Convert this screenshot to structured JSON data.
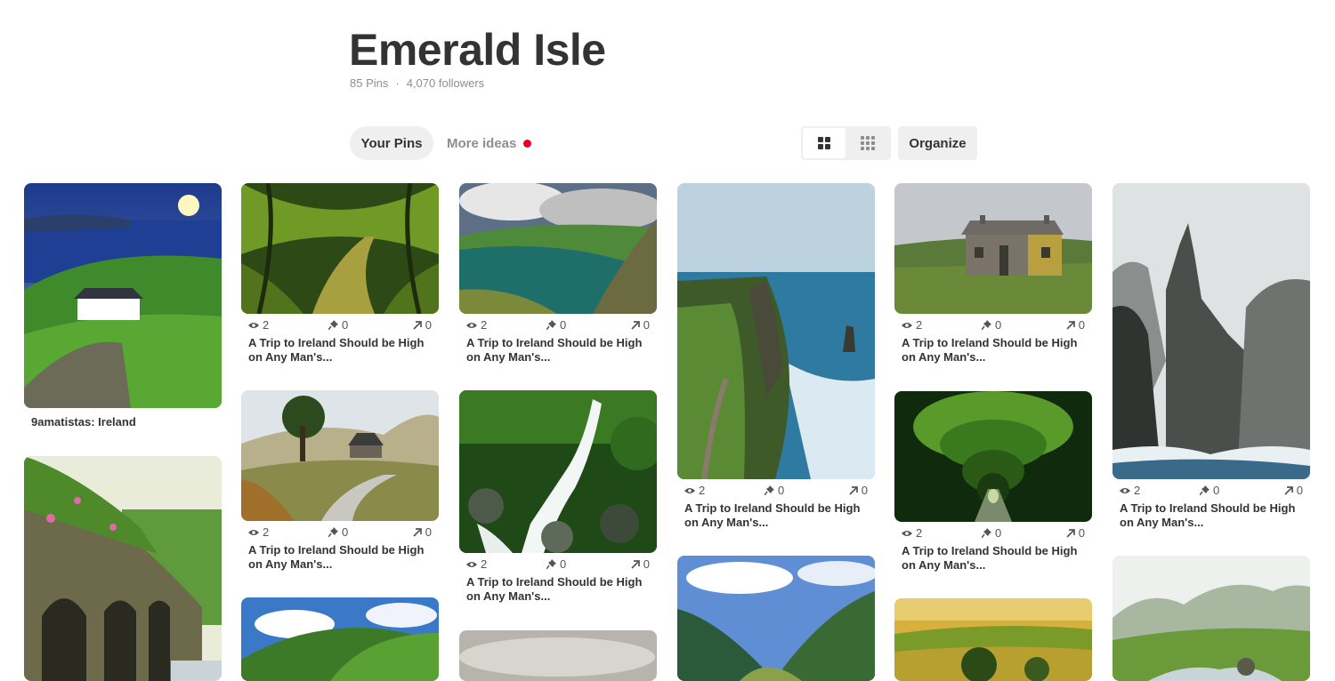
{
  "board": {
    "title": "Emerald Isle",
    "pins_count": "85 Pins",
    "separator": "·",
    "followers": "4,070 followers"
  },
  "tabs": {
    "your_pins": "Your Pins",
    "more_ideas": "More ideas"
  },
  "toolbar": {
    "organize_label": "Organize"
  },
  "pins": {
    "first_title": "9amatistas: Ireland",
    "trip_title_line1": "A Trip to Ireland Should be High",
    "trip_title_line2": "on Any Man's...",
    "views": "2",
    "saves": "0",
    "clicks": "0"
  },
  "colors": {
    "accent": "#e60023",
    "button_bg": "#efefef",
    "muted_text": "#8e8e8e"
  },
  "icons": {
    "views": "eye-icon",
    "saves": "pin-icon",
    "clicks": "arrow-up-right-icon"
  }
}
